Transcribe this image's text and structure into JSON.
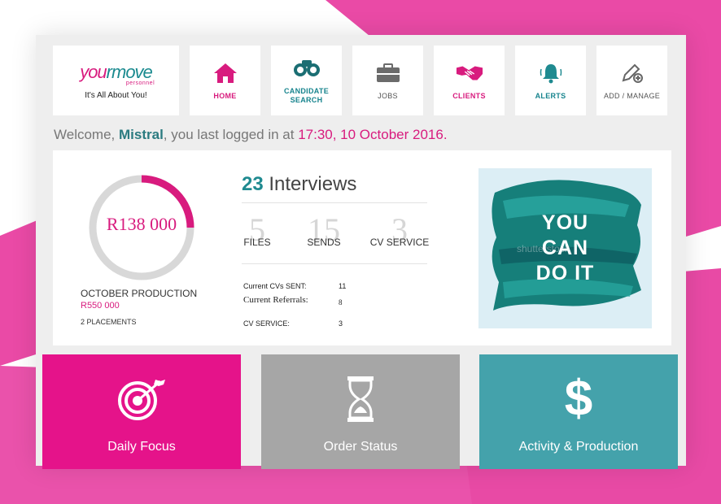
{
  "logo": {
    "word_you": "you",
    "word_move": "rmove",
    "sub": "personnel",
    "tagline": "It's All About You!"
  },
  "nav": {
    "home": "HOME",
    "candidate_search_1": "CANDIDATE",
    "candidate_search_2": "SEARCH",
    "jobs": "JOBS",
    "clients": "CLIENTS",
    "alerts": "ALERTS",
    "add_manage": "ADD / MANAGE"
  },
  "welcome": {
    "prefix": "Welcome, ",
    "name": "Mistral",
    "middle": ", you last logged in at ",
    "datetime": "17:30, 10 October 2016."
  },
  "production": {
    "amount": "R138 000",
    "label": "OCTOBER PRODUCTION",
    "target": "R550 000",
    "placements": "2 PLACEMENTS",
    "progress": 0.25
  },
  "interviews": {
    "count": "23",
    "label": "Interviews"
  },
  "stats": [
    {
      "num": "5",
      "label": "FILES"
    },
    {
      "num": "15",
      "label": "SENDS"
    },
    {
      "num": "3",
      "label": "CV SERVICE"
    }
  ],
  "details": [
    {
      "label": "Current CVs SENT:",
      "value": "11"
    },
    {
      "label": "Current Referrals:",
      "value": "8"
    },
    {
      "label": "CV SERVICE:",
      "value": "3"
    }
  ],
  "poster": {
    "line1": "YOU",
    "line2": "CAN",
    "line3": "DO IT",
    "watermark": "shutterstock"
  },
  "actions": [
    {
      "label": "Daily Focus",
      "color": "#e5138a"
    },
    {
      "label": "Order Status",
      "color": "#a6a6a6"
    },
    {
      "label": "Activity & Production",
      "color": "#44a2ab"
    }
  ],
  "colors": {
    "pink": "#d81b7e",
    "teal": "#1f8a90",
    "bg_pink": "#ec4fa8"
  }
}
